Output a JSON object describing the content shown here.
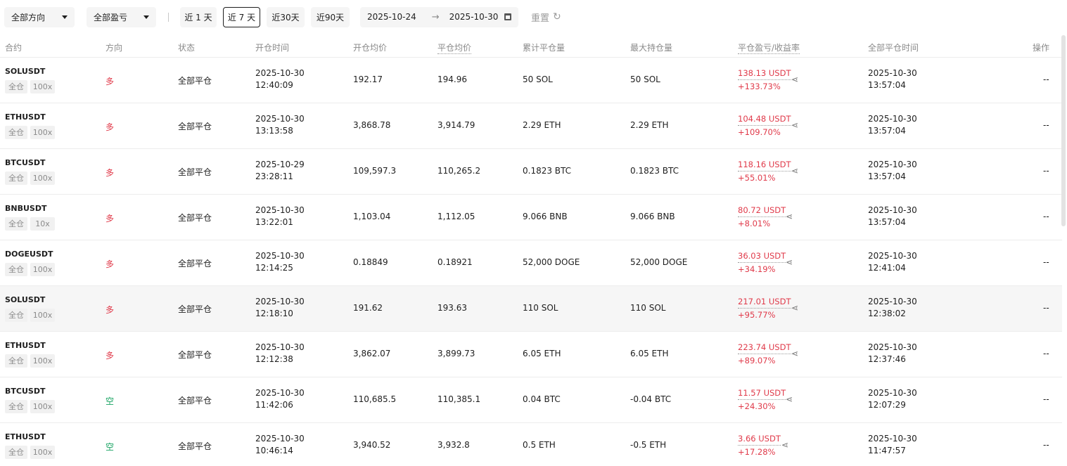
{
  "filters": {
    "direction": "全部方向",
    "pnl": "全部盈亏",
    "quick": [
      "近 1 天",
      "近 7 天",
      "近30天",
      "近90天"
    ],
    "date_start": "2025-10-24",
    "date_end": "2025-10-30",
    "reset": "重置"
  },
  "columns": {
    "contract": "合约",
    "direction": "方向",
    "status": "状态",
    "open_time": "开仓时间",
    "avg_open": "开仓均价",
    "avg_close": "平仓均价",
    "closed_qty": "累计平仓量",
    "max_pos": "最大持仓量",
    "pnl": "平仓盈亏/收益率",
    "close_time": "全部平仓时间",
    "action": "操作"
  },
  "colors": {
    "long": "#e03a4a",
    "short": "#19a463"
  },
  "rows": [
    {
      "symbol": "SOLUSDT",
      "margin": "全仓",
      "leverage": "100x",
      "direction": "多",
      "dir_type": "long",
      "status": "全部平仓",
      "open_date": "2025-10-30",
      "open_time": "12:40:09",
      "avg_open": "192.17",
      "avg_close": "194.96",
      "closed": "50 SOL",
      "max": "50 SOL",
      "pnl": "138.13 USDT",
      "roi": "+133.73%",
      "close_date": "2025-10-30",
      "close_time": "13:57:04",
      "action": "--"
    },
    {
      "symbol": "ETHUSDT",
      "margin": "全仓",
      "leverage": "100x",
      "direction": "多",
      "dir_type": "long",
      "status": "全部平仓",
      "open_date": "2025-10-30",
      "open_time": "13:13:58",
      "avg_open": "3,868.78",
      "avg_close": "3,914.79",
      "closed": "2.29 ETH",
      "max": "2.29 ETH",
      "pnl": "104.48 USDT",
      "roi": "+109.70%",
      "close_date": "2025-10-30",
      "close_time": "13:57:04",
      "action": "--"
    },
    {
      "symbol": "BTCUSDT",
      "margin": "全仓",
      "leverage": "100x",
      "direction": "多",
      "dir_type": "long",
      "status": "全部平仓",
      "open_date": "2025-10-29",
      "open_time": "23:28:11",
      "avg_open": "109,597.3",
      "avg_close": "110,265.2",
      "closed": "0.1823 BTC",
      "max": "0.1823 BTC",
      "pnl": "118.16 USDT",
      "roi": "+55.01%",
      "close_date": "2025-10-30",
      "close_time": "13:57:04",
      "action": "--"
    },
    {
      "symbol": "BNBUSDT",
      "margin": "全仓",
      "leverage": "10x",
      "direction": "多",
      "dir_type": "long",
      "status": "全部平仓",
      "open_date": "2025-10-30",
      "open_time": "13:22:01",
      "avg_open": "1,103.04",
      "avg_close": "1,112.05",
      "closed": "9.066 BNB",
      "max": "9.066 BNB",
      "pnl": "80.72 USDT",
      "roi": "+8.01%",
      "close_date": "2025-10-30",
      "close_time": "13:57:04",
      "action": "--"
    },
    {
      "symbol": "DOGEUSDT",
      "margin": "全仓",
      "leverage": "100x",
      "direction": "多",
      "dir_type": "long",
      "status": "全部平仓",
      "open_date": "2025-10-30",
      "open_time": "12:14:25",
      "avg_open": "0.18849",
      "avg_close": "0.18921",
      "closed": "52,000 DOGE",
      "max": "52,000 DOGE",
      "pnl": "36.03 USDT",
      "roi": "+34.19%",
      "close_date": "2025-10-30",
      "close_time": "12:41:04",
      "action": "--"
    },
    {
      "symbol": "SOLUSDT",
      "margin": "全仓",
      "leverage": "100x",
      "direction": "多",
      "dir_type": "long",
      "status": "全部平仓",
      "open_date": "2025-10-30",
      "open_time": "12:18:10",
      "avg_open": "191.62",
      "avg_close": "193.63",
      "closed": "110 SOL",
      "max": "110 SOL",
      "pnl": "217.01 USDT",
      "roi": "+95.77%",
      "close_date": "2025-10-30",
      "close_time": "12:38:02",
      "action": "--"
    },
    {
      "symbol": "ETHUSDT",
      "margin": "全仓",
      "leverage": "100x",
      "direction": "多",
      "dir_type": "long",
      "status": "全部平仓",
      "open_date": "2025-10-30",
      "open_time": "12:12:38",
      "avg_open": "3,862.07",
      "avg_close": "3,899.73",
      "closed": "6.05 ETH",
      "max": "6.05 ETH",
      "pnl": "223.74 USDT",
      "roi": "+89.07%",
      "close_date": "2025-10-30",
      "close_time": "12:37:46",
      "action": "--"
    },
    {
      "symbol": "BTCUSDT",
      "margin": "全仓",
      "leverage": "100x",
      "direction": "空",
      "dir_type": "short",
      "status": "全部平仓",
      "open_date": "2025-10-30",
      "open_time": "11:42:06",
      "avg_open": "110,685.5",
      "avg_close": "110,385.1",
      "closed": "0.04 BTC",
      "max": "-0.04 BTC",
      "pnl": "11.57 USDT",
      "roi": "+24.30%",
      "close_date": "2025-10-30",
      "close_time": "12:07:29",
      "action": "--"
    },
    {
      "symbol": "ETHUSDT",
      "margin": "全仓",
      "leverage": "100x",
      "direction": "空",
      "dir_type": "short",
      "status": "全部平仓",
      "open_date": "2025-10-30",
      "open_time": "10:46:14",
      "avg_open": "3,940.52",
      "avg_close": "3,932.8",
      "closed": "0.5 ETH",
      "max": "-0.5 ETH",
      "pnl": "3.66 USDT",
      "roi": "+17.28%",
      "close_date": "2025-10-30",
      "close_time": "11:47:57",
      "action": "--"
    }
  ]
}
